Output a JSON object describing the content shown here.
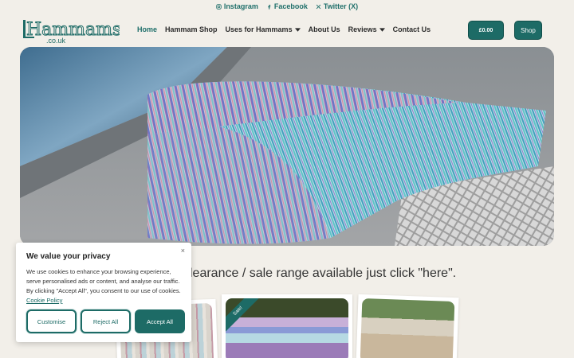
{
  "topbar": {
    "links": [
      {
        "label": "Instagram",
        "icon": "instagram-icon"
      },
      {
        "label": "Facebook",
        "icon": "facebook-icon"
      },
      {
        "label": "Twitter (X)",
        "icon": "x-icon"
      }
    ]
  },
  "brand": {
    "logo_main": "Hammams",
    "logo_sub": ".co.uk",
    "accent": "#1d6b66"
  },
  "nav": {
    "items": [
      {
        "label": "Home",
        "active": true,
        "dropdown": false
      },
      {
        "label": "Hammam Shop",
        "active": false,
        "dropdown": false
      },
      {
        "label": "Uses for Hammams",
        "active": false,
        "dropdown": true
      },
      {
        "label": "About Us",
        "active": false,
        "dropdown": false
      },
      {
        "label": "Reviews",
        "active": false,
        "dropdown": true
      },
      {
        "label": "Contact Us",
        "active": false,
        "dropdown": false
      }
    ],
    "cart_label": "£0.00",
    "shop_label": "Shop"
  },
  "promo": {
    "text": "clearance / sale range available just click \"here\"."
  },
  "thumbnails": {
    "sale_badge": "Sale!"
  },
  "cookie": {
    "title": "We value your privacy",
    "body": "We use cookies to enhance your browsing experience, serve personalised ads or content, and analyse our traffic. By clicking \"Accept All\", you consent to our use of cookies.",
    "policy_link": "Cookie Policy",
    "close_symbol": "×",
    "customise_label": "Customise",
    "reject_label": "Reject All",
    "accept_label": "Accept All"
  }
}
